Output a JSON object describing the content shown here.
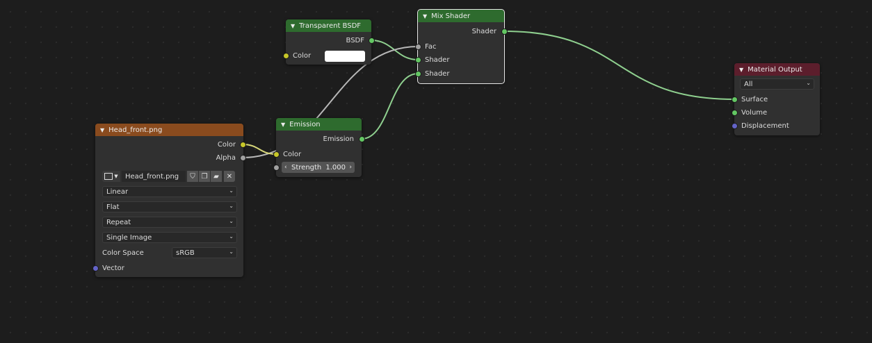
{
  "nodes": {
    "transparent_bsdf": {
      "title": "Transparent BSDF",
      "output": "BSDF",
      "input_color_label": "Color",
      "color_value": "#ffffff"
    },
    "mix_shader": {
      "title": "Mix Shader",
      "output": "Shader",
      "inputs": [
        "Fac",
        "Shader",
        "Shader"
      ]
    },
    "emission": {
      "title": "Emission",
      "output": "Emission",
      "input_color_label": "Color",
      "strength_label": "Strength",
      "strength_value": "1.000"
    },
    "image_texture": {
      "title": "Head_front.png",
      "outputs": [
        "Color",
        "Alpha"
      ],
      "image_name": "Head_front.png",
      "interpolation": "Linear",
      "projection": "Flat",
      "extension": "Repeat",
      "source": "Single Image",
      "color_space_label": "Color Space",
      "color_space": "sRGB",
      "vector_label": "Vector"
    },
    "material_output": {
      "title": "Material Output",
      "target": "All",
      "inputs": [
        "Surface",
        "Volume",
        "Displacement"
      ]
    }
  },
  "colors": {
    "shader_socket": "#63c763",
    "color_socket": "#c7c729",
    "float_socket": "#a1a1a1",
    "vector_socket": "#6363c7",
    "shader_header": "#2e6b2e",
    "texture_header": "#8a4b1e",
    "output_header": "#5c1e2c"
  },
  "icons": [
    "chevron-down-icon",
    "image-icon",
    "shield-icon",
    "duplicate-icon",
    "folder-icon",
    "close-icon"
  ]
}
